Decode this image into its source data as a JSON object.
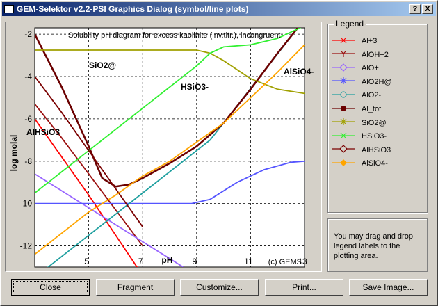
{
  "window": {
    "title": "GEM-Selektor v2.2-PSI Graphics Dialog (symbol/line plots)",
    "help_label": "?",
    "close_label": "X"
  },
  "plot": {
    "title": "Solubility pH diagram for excess kaolinite (inv.titr.), incongruent",
    "xlabel": "pH",
    "ylabel": "log molal",
    "copyright": "(c) GEMS",
    "annotations": [
      {
        "text": "SiO2@"
      },
      {
        "text": "HSiO3-"
      },
      {
        "text": "AlSiO4-"
      },
      {
        "text": "AlHSiO3"
      }
    ]
  },
  "chart_data": {
    "type": "line",
    "title": "Solubility pH diagram for excess kaolinite (inv.titr.), incongruent",
    "xlabel": "pH",
    "ylabel": "log molal",
    "xlim": [
      3,
      13
    ],
    "ylim": [
      -13,
      -1.7
    ],
    "xticks": [
      5,
      7,
      9,
      11,
      13
    ],
    "yticks": [
      -2,
      -4,
      -6,
      -8,
      -10,
      -12
    ],
    "grid": true,
    "legend_position": "right",
    "series": [
      {
        "name": "Al+3",
        "color": "#ff0000",
        "x": [
          3,
          4,
          5,
          6,
          7
        ],
        "y": [
          -6.0,
          -7.8,
          -9.6,
          -11.5,
          -13.4
        ]
      },
      {
        "name": "AlOH+2",
        "color": "#9b1010",
        "x": [
          3,
          4,
          5,
          6,
          7
        ],
        "y": [
          -5.3,
          -6.9,
          -8.6,
          -10.3,
          -12.0
        ]
      },
      {
        "name": "AlO+",
        "color": "#9966ff",
        "x": [
          3,
          4,
          5,
          6,
          7,
          8,
          8.5
        ],
        "y": [
          -8.6,
          -9.4,
          -10.2,
          -11.0,
          -11.8,
          -12.6,
          -13.0
        ]
      },
      {
        "name": "AlO2H@",
        "color": "#5555ff",
        "x": [
          3,
          8.8,
          9.5,
          10.5,
          11.5,
          12.5,
          13
        ],
        "y": [
          -10.0,
          -10.0,
          -9.8,
          -9.0,
          -8.4,
          -8.05,
          -8.0
        ]
      },
      {
        "name": "AlO2-",
        "color": "#20a0a0",
        "x": [
          3,
          5,
          7,
          9,
          9.5,
          10,
          13
        ],
        "y": [
          -13.5,
          -11.5,
          -9.5,
          -7.5,
          -7.0,
          -6.2,
          -1.3
        ]
      },
      {
        "name": "Al_tot",
        "color": "#6b0000",
        "x": [
          3,
          4,
          5,
          5.5,
          6,
          6.5,
          7,
          8,
          9,
          10,
          11,
          12,
          13
        ],
        "y": [
          -2.0,
          -4.5,
          -7.3,
          -8.8,
          -9.2,
          -9.1,
          -8.8,
          -8.1,
          -7.3,
          -6.2,
          -4.6,
          -2.9,
          -1.3
        ]
      },
      {
        "name": "SiO2@",
        "color": "#a0a000",
        "x": [
          3,
          4,
          5,
          6,
          7,
          8,
          9,
          9.5,
          10,
          11,
          12,
          13
        ],
        "y": [
          -2.75,
          -2.75,
          -2.75,
          -2.75,
          -2.75,
          -2.75,
          -2.75,
          -2.9,
          -3.25,
          -4.1,
          -4.6,
          -4.8
        ]
      },
      {
        "name": "HSiO3-",
        "color": "#30f030",
        "x": [
          3,
          4,
          5,
          6,
          7,
          8,
          9,
          9.5,
          10,
          11,
          12,
          13
        ],
        "y": [
          -9.5,
          -8.5,
          -7.5,
          -6.5,
          -5.5,
          -4.5,
          -3.5,
          -2.9,
          -2.6,
          -2.5,
          -2.2,
          -1.6
        ]
      },
      {
        "name": "AlHSiO3",
        "color": "#7a0000",
        "x": [
          3,
          4,
          5,
          6,
          7
        ],
        "y": [
          -4.0,
          -5.7,
          -7.5,
          -9.3,
          -11.1
        ]
      },
      {
        "name": "AlSiO4-",
        "color": "#ffa500",
        "x": [
          3,
          4,
          5,
          6,
          7,
          8,
          9,
          10,
          11,
          12,
          13
        ],
        "y": [
          -12.4,
          -11.4,
          -10.4,
          -9.6,
          -8.7,
          -8.0,
          -7.1,
          -6.2,
          -5.0,
          -3.8,
          -2.5
        ]
      }
    ]
  },
  "legend": {
    "title": "Legend",
    "items": [
      {
        "label": "Al+3",
        "color": "#ff0000",
        "marker": "x"
      },
      {
        "label": "AlOH+2",
        "color": "#9b1010",
        "marker": "y"
      },
      {
        "label": "AlO+",
        "color": "#9966ff",
        "marker": "diamond-open"
      },
      {
        "label": "AlO2H@",
        "color": "#5555ff",
        "marker": "star"
      },
      {
        "label": "AlO2-",
        "color": "#20a0a0",
        "marker": "circle-open"
      },
      {
        "label": "Al_tot",
        "color": "#6b0000",
        "marker": "circle-filled"
      },
      {
        "label": "SiO2@",
        "color": "#a0a000",
        "marker": "asterisk"
      },
      {
        "label": "HSiO3-",
        "color": "#30f030",
        "marker": "x"
      },
      {
        "label": "AlHSiO3",
        "color": "#7a0000",
        "marker": "diamond-open"
      },
      {
        "label": "AlSiO4-",
        "color": "#ffa500",
        "marker": "diamond-filled"
      }
    ]
  },
  "info_text": "You may drag and drop legend labels to the plotting area.",
  "buttons": {
    "close": "Close",
    "fragment": "Fragment",
    "customize": "Customize...",
    "print": "Print...",
    "save_image": "Save Image..."
  }
}
